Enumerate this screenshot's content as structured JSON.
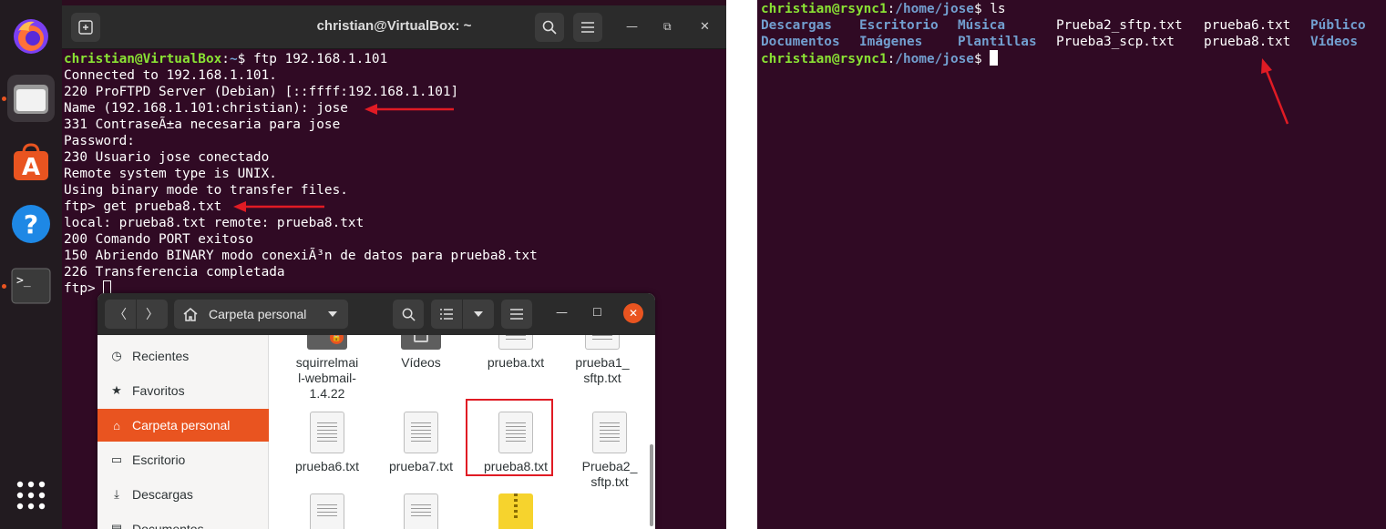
{
  "left_terminal": {
    "title": "christian@VirtualBox: ~",
    "prompt_user": "christian@VirtualBox",
    "prompt_sep": ":",
    "prompt_path": "~",
    "prompt_end": "$ ",
    "command": "ftp 192.168.1.101",
    "lines": [
      "Connected to 192.168.1.101.",
      "220 ProFTPD Server (Debian) [::ffff:192.168.1.101]",
      "Name (192.168.1.101:christian): jose",
      "331 ContraseÃ±a necesaria para jose",
      "Password:",
      "230 Usuario jose conectado",
      "Remote system type is UNIX.",
      "Using binary mode to transfer files.",
      "ftp> get prueba8.txt",
      "local: prueba8.txt remote: prueba8.txt",
      "200 Comando PORT exitoso",
      "150 Abriendo BINARY modo conexiÃ³n de datos para prueba8.txt",
      "226 Transferencia completada",
      "ftp> "
    ]
  },
  "file_manager": {
    "location": "Carpeta personal",
    "sidebar": [
      {
        "label": "Recientes",
        "icon": "clock-icon"
      },
      {
        "label": "Favoritos",
        "icon": "star-icon"
      },
      {
        "label": "Carpeta personal",
        "icon": "home-icon",
        "active": true
      },
      {
        "label": "Escritorio",
        "icon": "desktop-icon"
      },
      {
        "label": "Descargas",
        "icon": "download-icon"
      },
      {
        "label": "Documentos",
        "icon": "document-icon"
      }
    ],
    "files": [
      {
        "name": "squirrelmai\nl-webmail-\n1.4.22"
      },
      {
        "name": "Vídeos"
      },
      {
        "name": "prueba.txt"
      },
      {
        "name": "prueba1_\nsftp.txt"
      },
      {
        "name": "prueba6.txt"
      },
      {
        "name": "prueba7.txt"
      },
      {
        "name": "prueba8.txt",
        "highlighted": true
      },
      {
        "name": "Prueba2_\nsftp.txt"
      }
    ]
  },
  "right_terminal": {
    "prompt_user": "christian@rsync1",
    "prompt_sep": ":",
    "prompt_path": "/home/jose",
    "prompt_end": "$ ",
    "command": "ls",
    "listing_row1": [
      "Descargas",
      "Escritorio",
      "Música",
      "Prueba2_sftp.txt",
      "prueba6.txt",
      "Público"
    ],
    "listing_row2": [
      "Documentos",
      "Imágenes",
      "Plantillas",
      "Prueba3_scp.txt",
      "prueba8.txt",
      "Vídeos"
    ]
  },
  "colors": {
    "terminal_bg": "#300a24",
    "prompt_green": "#8ae234",
    "prompt_blue": "#729fcf",
    "accent_orange": "#e95420",
    "annotation_red": "#e01b24"
  }
}
